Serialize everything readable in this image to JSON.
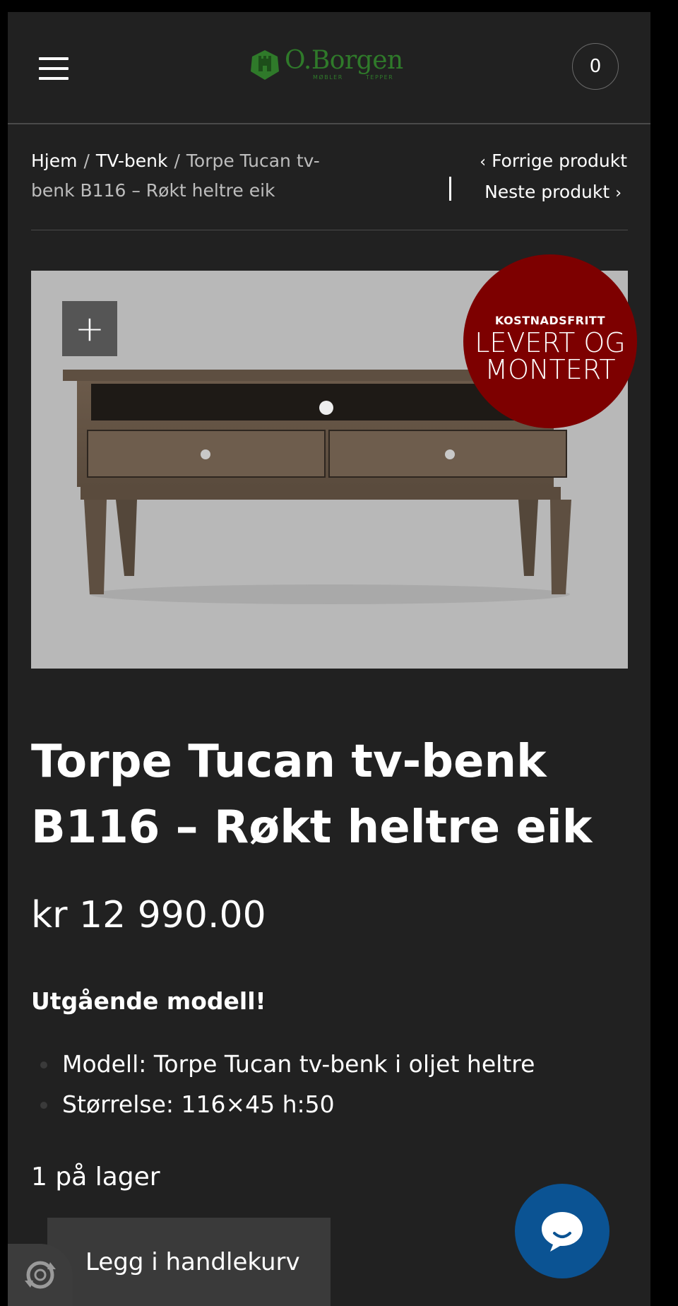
{
  "header": {
    "logo_text": "O.Borgen",
    "logo_sub_left": "MØBLER",
    "logo_sub_right": "TEPPER",
    "cart_count": "0"
  },
  "breadcrumb": {
    "home": "Hjem",
    "sep": "/",
    "category": "TV-benk",
    "current": "Torpe Tucan tv-benk B116 – Røkt heltre eik"
  },
  "product_nav": {
    "prev": "Forrige produkt",
    "next": "Neste produkt"
  },
  "badge": {
    "line1": "KOSTNADSFRITT",
    "line2": "LEVERT OG",
    "line3": "MONTERT"
  },
  "product": {
    "title": "Torpe Tucan tv-benk B116 – Røkt heltre eik",
    "price": "kr 12 990.00",
    "note": "Utgående modell!",
    "specs": [
      "Modell: Torpe Tucan tv-benk i oljet heltre",
      "Størrelse: 116×45 h:50"
    ],
    "stock": "1 på lager",
    "add_to_cart": "Legg i handlekurv"
  },
  "colors": {
    "background": "#212121",
    "logo_green": "#2f7a2a",
    "badge_red": "#7d0000",
    "chat_blue": "#0b5393"
  },
  "icons": [
    "hamburger-icon",
    "cart-icon",
    "chevron-left-icon",
    "chevron-right-icon",
    "zoom-plus-icon",
    "chat-icon",
    "recaptcha-icon"
  ]
}
